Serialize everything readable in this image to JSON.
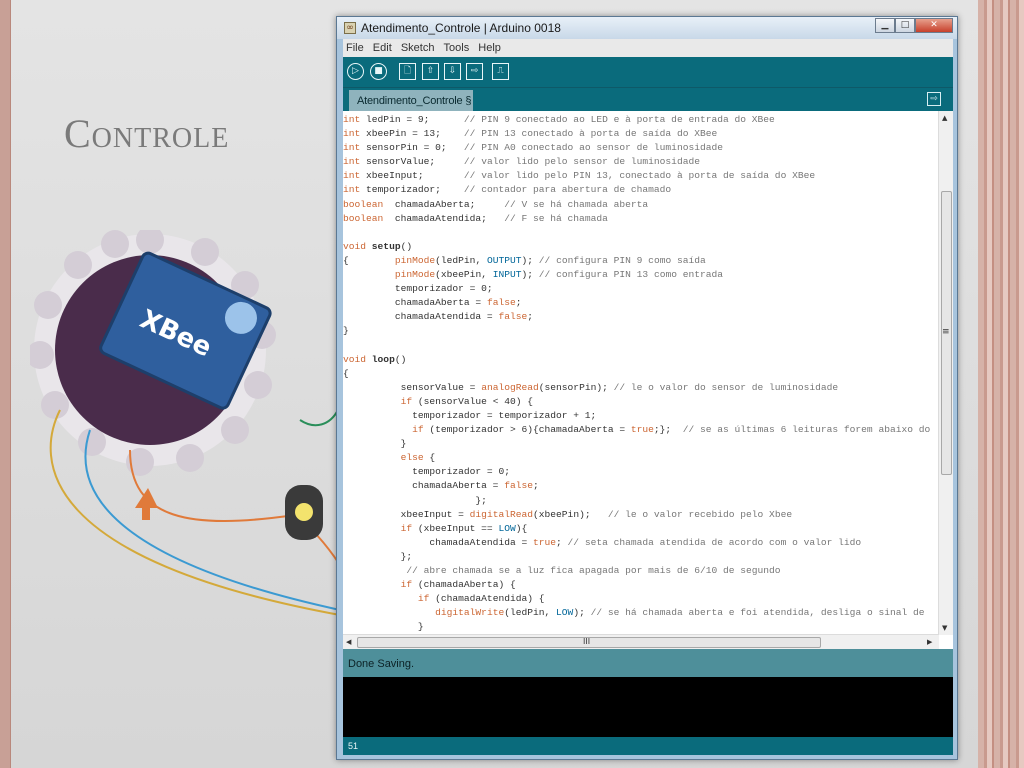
{
  "slide": {
    "title": "Controle"
  },
  "window": {
    "title": "Atendimento_Controle | Arduino 0018",
    "controls": {
      "minimize": "▁",
      "maximize": "□",
      "close": "✕"
    }
  },
  "menu": [
    "File",
    "Edit",
    "Sketch",
    "Tools",
    "Help"
  ],
  "toolbar": {
    "verify_icon": "▷",
    "stop_icon": "■",
    "new_icon": "🗋",
    "open_icon": "⇧",
    "save_icon": "⇩",
    "upload_icon": "⇨",
    "serial_monitor_icon": "⎍"
  },
  "tab": {
    "label": "Atendimento_Controle §",
    "menu_icon": "⇨"
  },
  "code_lines": [
    [
      [
        "k",
        "int"
      ],
      [
        "t",
        " ledPin = 9;      "
      ],
      [
        "c",
        "// PIN 9 conectado ao LED e à porta de entrada do XBee"
      ]
    ],
    [
      [
        "k",
        "int"
      ],
      [
        "t",
        " xbeePin = 13;    "
      ],
      [
        "c",
        "// PIN 13 conectado à porta de saída do XBee"
      ]
    ],
    [
      [
        "k",
        "int"
      ],
      [
        "t",
        " sensorPin = 0;   "
      ],
      [
        "c",
        "// PIN A0 conectado ao sensor de luminosidade"
      ]
    ],
    [
      [
        "k",
        "int"
      ],
      [
        "t",
        " sensorValue;     "
      ],
      [
        "c",
        "// valor lido pelo sensor de luminosidade"
      ]
    ],
    [
      [
        "k",
        "int"
      ],
      [
        "t",
        " xbeeInput;       "
      ],
      [
        "c",
        "// valor lido pelo PIN 13, conectado à porta de saída do XBee"
      ]
    ],
    [
      [
        "k",
        "int"
      ],
      [
        "t",
        " temporizador;    "
      ],
      [
        "c",
        "// contador para abertura de chamado"
      ]
    ],
    [
      [
        "k",
        "boolean"
      ],
      [
        "t",
        "  chamadaAberta;     "
      ],
      [
        "c",
        "// V se há chamada aberta"
      ]
    ],
    [
      [
        "k",
        "boolean"
      ],
      [
        "t",
        "  chamadaAtendida;   "
      ],
      [
        "c",
        "// F se há chamada"
      ]
    ],
    [
      [
        "t",
        ""
      ]
    ],
    [
      [
        "k",
        "void"
      ],
      [
        "t",
        " "
      ],
      [
        "b",
        "setup"
      ],
      [
        "t",
        "()"
      ]
    ],
    [
      [
        "t",
        "{        "
      ],
      [
        "f",
        "pinMode"
      ],
      [
        "t",
        "(ledPin, "
      ],
      [
        "lit",
        "OUTPUT"
      ],
      [
        "t",
        "); "
      ],
      [
        "c",
        "// configura PIN 9 como saída"
      ]
    ],
    [
      [
        "t",
        "         "
      ],
      [
        "f",
        "pinMode"
      ],
      [
        "t",
        "(xbeePin, "
      ],
      [
        "lit",
        "INPUT"
      ],
      [
        "t",
        "); "
      ],
      [
        "c",
        "// configura PIN 13 como entrada"
      ]
    ],
    [
      [
        "t",
        "         temporizador = 0;"
      ]
    ],
    [
      [
        "t",
        "         chamadaAberta = "
      ],
      [
        "f",
        "false"
      ],
      [
        "t",
        ";"
      ]
    ],
    [
      [
        "t",
        "         chamadaAtendida = "
      ],
      [
        "f",
        "false"
      ],
      [
        "t",
        ";"
      ]
    ],
    [
      [
        "t",
        "}"
      ]
    ],
    [
      [
        "t",
        ""
      ]
    ],
    [
      [
        "k",
        "void"
      ],
      [
        "t",
        " "
      ],
      [
        "b",
        "loop"
      ],
      [
        "t",
        "()"
      ]
    ],
    [
      [
        "t",
        "{"
      ]
    ],
    [
      [
        "t",
        "          sensorValue = "
      ],
      [
        "f",
        "analogRead"
      ],
      [
        "t",
        "(sensorPin); "
      ],
      [
        "c",
        "// le o valor do sensor de luminosidade"
      ]
    ],
    [
      [
        "t",
        "          "
      ],
      [
        "k",
        "if"
      ],
      [
        "t",
        " (sensorValue < 40) {"
      ]
    ],
    [
      [
        "t",
        "            temporizador = temporizador + 1;"
      ]
    ],
    [
      [
        "t",
        "            "
      ],
      [
        "k",
        "if"
      ],
      [
        "t",
        " (temporizador > 6){chamadaAberta = "
      ],
      [
        "f",
        "true"
      ],
      [
        "t",
        ";};  "
      ],
      [
        "c",
        "// se as últimas 6 leituras forem abaixo do"
      ]
    ],
    [
      [
        "t",
        "          }"
      ]
    ],
    [
      [
        "t",
        "          "
      ],
      [
        "k",
        "else"
      ],
      [
        "t",
        " {"
      ]
    ],
    [
      [
        "t",
        "            temporizador = 0;"
      ]
    ],
    [
      [
        "t",
        "            chamadaAberta = "
      ],
      [
        "f",
        "false"
      ],
      [
        "t",
        ";"
      ]
    ],
    [
      [
        "t",
        "                       };"
      ]
    ],
    [
      [
        "t",
        "          xbeeInput = "
      ],
      [
        "f",
        "digitalRead"
      ],
      [
        "t",
        "(xbeePin);   "
      ],
      [
        "c",
        "// le o valor recebido pelo Xbee"
      ]
    ],
    [
      [
        "t",
        "          "
      ],
      [
        "k",
        "if"
      ],
      [
        "t",
        " (xbeeInput == "
      ],
      [
        "lit",
        "LOW"
      ],
      [
        "t",
        "){"
      ]
    ],
    [
      [
        "t",
        "               chamadaAtendida = "
      ],
      [
        "f",
        "true"
      ],
      [
        "t",
        "; "
      ],
      [
        "c",
        "// seta chamada atendida de acordo com o valor lido"
      ]
    ],
    [
      [
        "t",
        "          };"
      ]
    ],
    [
      [
        "t",
        "           "
      ],
      [
        "c",
        "// abre chamada se a luz fica apagada por mais de 6/10 de segundo"
      ]
    ],
    [
      [
        "t",
        "          "
      ],
      [
        "k",
        "if"
      ],
      [
        "t",
        " (chamadaAberta) {"
      ]
    ],
    [
      [
        "t",
        "             "
      ],
      [
        "k",
        "if"
      ],
      [
        "t",
        " (chamadaAtendida) {"
      ]
    ],
    [
      [
        "t",
        "                "
      ],
      [
        "f",
        "digitalWrite"
      ],
      [
        "t",
        "(ledPin, "
      ],
      [
        "lit",
        "LOW"
      ],
      [
        "t",
        "); "
      ],
      [
        "c",
        "// se há chamada aberta e foi atendida, desliga o sinal de"
      ]
    ],
    [
      [
        "t",
        "             }"
      ]
    ]
  ],
  "scroll": {
    "h_middle": "III",
    "v_middle": "≡"
  },
  "status": "Done Saving.",
  "line_number": "51"
}
